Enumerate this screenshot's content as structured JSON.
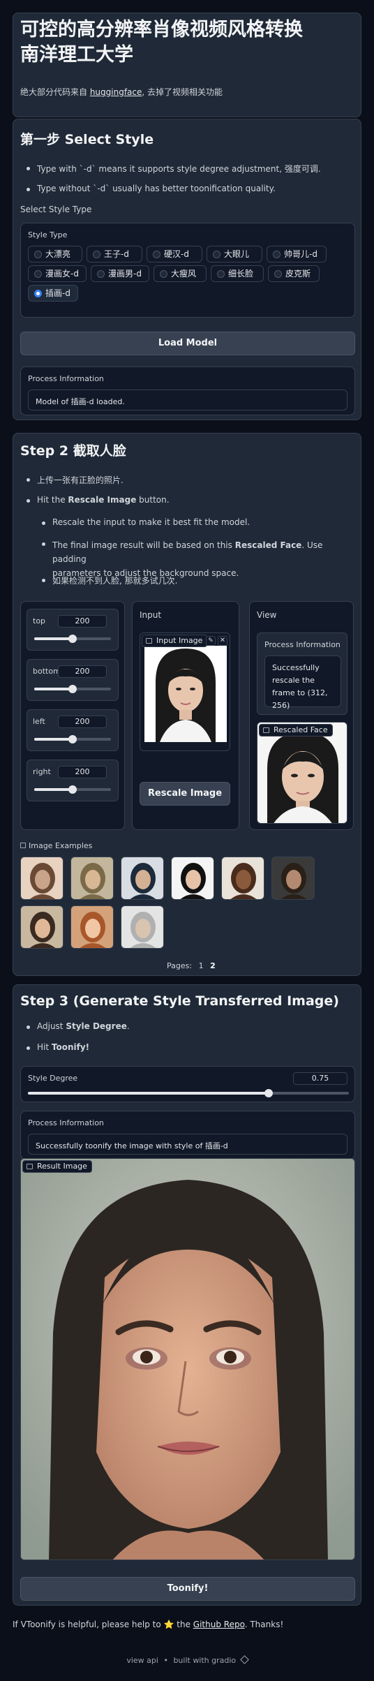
{
  "header": {
    "title_line1": "可控的高分辨率肖像视频风格转换",
    "title_line2": "南洋理工大学",
    "intro_prefix": "绝大部分代码来自 ",
    "intro_link": "huggingface",
    "intro_suffix": ", 去掉了视频相关功能"
  },
  "step1": {
    "title": "第一步 Select Style",
    "bullets": [
      "Type with `-d` means it supports style degree adjustment, 强度可调.",
      "Type without `-d` usually has better toonification quality."
    ],
    "select_label": "Select Style Type",
    "style_type_label": "Style Type",
    "styles": [
      "大漂亮",
      "王子-d",
      "硬汉-d",
      "大眼儿",
      "帅哥儿-d",
      "漫画女-d",
      "漫画男-d",
      "大瘦风",
      "细长脸",
      "皮克斯",
      "插画-d"
    ],
    "selected": "插画-d",
    "load_button": "Load Model",
    "process_label": "Process Information",
    "process_text": "Model of 插画-d loaded."
  },
  "step2": {
    "title": "Step 2 截取人脸",
    "bullets": [
      "上传一张有正脸的照片.",
      "Hit the Rescale Image button."
    ],
    "bullet2_prefix": "Hit the ",
    "bullet2_bold": "Rescale Image",
    "bullet2_suffix": " button.",
    "sub_bullets": [
      "Rescale the input to make it best fit the model.",
      "The final image result will be based on this Rescaled Face. Use padding parameters to adjust the background space.",
      "如果检测不到人脸, 那就多试几次."
    ],
    "sub2_prefix": "The final image result will be based on this ",
    "sub2_bold": "Rescaled Face",
    "sub2_suffix": ". Use padding",
    "sub2_line2": "parameters to adjust the background space.",
    "padding": [
      {
        "label": "top",
        "value": "200"
      },
      {
        "label": "bottom",
        "value": "200"
      },
      {
        "label": "left",
        "value": "200"
      },
      {
        "label": "right",
        "value": "200"
      }
    ],
    "input_label": "Input",
    "input_image_tag": "Input Image",
    "rescale_button": "Rescale Image",
    "view_label": "View",
    "view_process_label": "Process Information",
    "view_process_text": "Successfully rescale the frame to (312, 256)",
    "rescaled_tag": "Rescaled Face",
    "examples_label": "Image Examples",
    "pages_label": "Pages:",
    "page_1": "1",
    "page_2": "2"
  },
  "step3": {
    "title": "Step 3 (Generate Style Transferred Image)",
    "bullet1_prefix": "Adjust ",
    "bullet1_bold": "Style Degree",
    "bullet1_suffix": ".",
    "bullet2_prefix": "Hit ",
    "bullet2_bold": "Toonify!",
    "degree_label": "Style Degree",
    "degree_value": "0.75",
    "degree_fraction": 0.75,
    "process_label": "Process Information",
    "process_text": "Successfully toonify the image with style of 插画-d",
    "result_tag": "Result Image",
    "toonify_button": "Toonify!"
  },
  "footer": {
    "text_prefix": "If VToonify is helpful, please help to ",
    "star": "⭐",
    "text_mid": " the ",
    "link": "Github Repo",
    "text_suffix": ". Thanks!",
    "api": "view api",
    "dot": "•",
    "built": "built with gradio"
  }
}
